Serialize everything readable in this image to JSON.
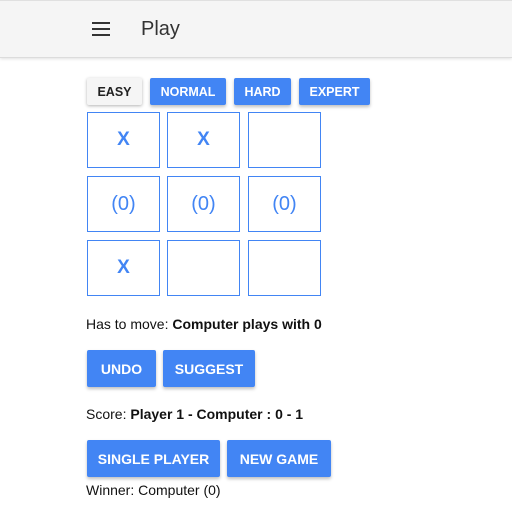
{
  "header": {
    "title": "Play",
    "menu_icon": "hamburger-menu-icon"
  },
  "difficulty": {
    "options": [
      "EASY",
      "NORMAL",
      "HARD",
      "EXPERT"
    ],
    "selected": "EASY"
  },
  "board": {
    "cells": [
      "X",
      "X",
      "",
      "(0)",
      "(0)",
      "(0)",
      "X",
      "",
      ""
    ]
  },
  "status": {
    "move_label": "Has to move:",
    "move_value": "Computer plays with 0",
    "score_label": "Score:",
    "score_value": "Player 1 - Computer : 0 - 1",
    "winner_text": "Winner: Computer (0)"
  },
  "actions": {
    "undo": "UNDO",
    "suggest": "SUGGEST",
    "single_player": "SINGLE PLAYER",
    "new_game": "NEW GAME"
  },
  "colors": {
    "accent": "#4285f4",
    "appbar": "#f5f5f5",
    "selected_button": "#f5f5f5"
  }
}
